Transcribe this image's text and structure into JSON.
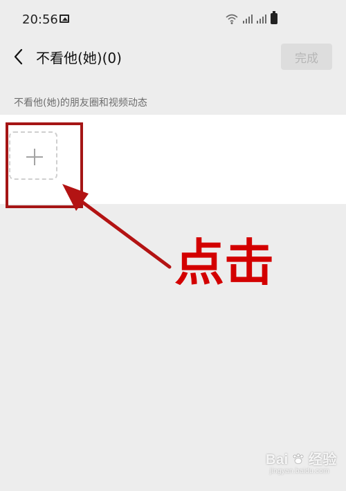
{
  "status_bar": {
    "time": "20:56",
    "icons": [
      "gallery-icon",
      "wifi-icon",
      "signal-icon",
      "signal-icon",
      "battery-icon"
    ]
  },
  "header": {
    "title": "不看他(她)(0)",
    "done_label": "完成",
    "back_icon": "chevron-left-icon"
  },
  "content": {
    "hint": "不看他(她)的朋友圈和视频动态",
    "add_icon": "plus-icon"
  },
  "annotation": {
    "label": "点击",
    "color": "#d30000",
    "border_color": "#a51515"
  },
  "watermark": {
    "brand_left": "Bai",
    "brand_right": "经验",
    "subtext": "jingyan.baidu.com"
  }
}
